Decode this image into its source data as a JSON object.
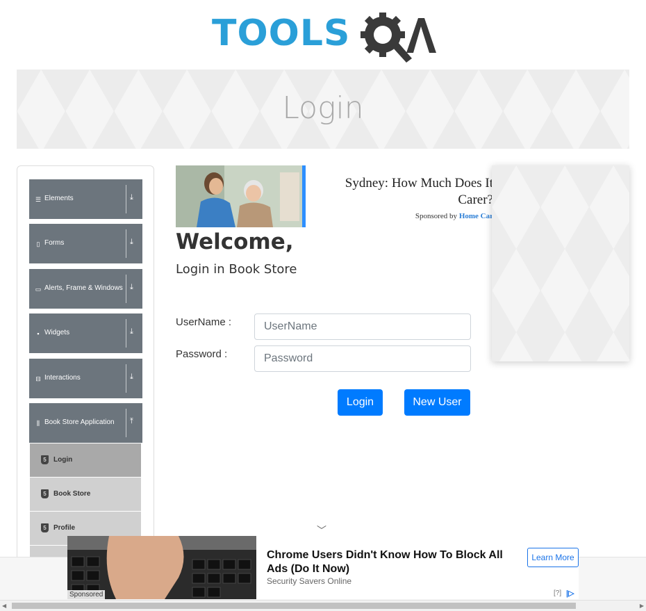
{
  "logo": {
    "text_tools": "TOOLS",
    "text_qa": "QA"
  },
  "banner": {
    "title": "Login"
  },
  "sidebar": {
    "groups": [
      {
        "label": "Elements",
        "icon": "menu-lines-icon"
      },
      {
        "label": "Forms",
        "icon": "document-icon"
      },
      {
        "label": "Alerts, Frame & Windows",
        "icon": "window-icon"
      },
      {
        "label": "Widgets",
        "icon": "grid-icon"
      },
      {
        "label": "Interactions",
        "icon": "interaction-icon"
      },
      {
        "label": "Book Store Application",
        "icon": "books-icon"
      }
    ],
    "subitems": [
      {
        "label": "Login",
        "active": true
      },
      {
        "label": "Book Store",
        "active": false
      },
      {
        "label": "Profile",
        "active": false
      }
    ]
  },
  "ad_top": {
    "headline_line1": "Sydney: How Much Does It",
    "headline_line2": "Carer?",
    "sponsored_prefix": "Sponsored by",
    "sponsored_brand": "Home Car"
  },
  "main": {
    "welcome": "Welcome,",
    "subtitle": "Login in Book Store",
    "username_label": "UserName :",
    "username_placeholder": "UserName",
    "password_label": "Password :",
    "password_placeholder": "Password",
    "login_button": "Login",
    "new_user_button": "New User"
  },
  "bottom_ad": {
    "sponsored": "Sponsored",
    "title": "Chrome Users Didn't Know How To Block All Ads (Do It Now)",
    "source": "Security Savers Online",
    "cta": "Learn More",
    "q": "[?]"
  },
  "colors": {
    "primary": "#007bff",
    "sidebar_group": "#6c757d",
    "logo_blue": "#2a9fd8",
    "logo_dark": "#3a3a3a"
  }
}
